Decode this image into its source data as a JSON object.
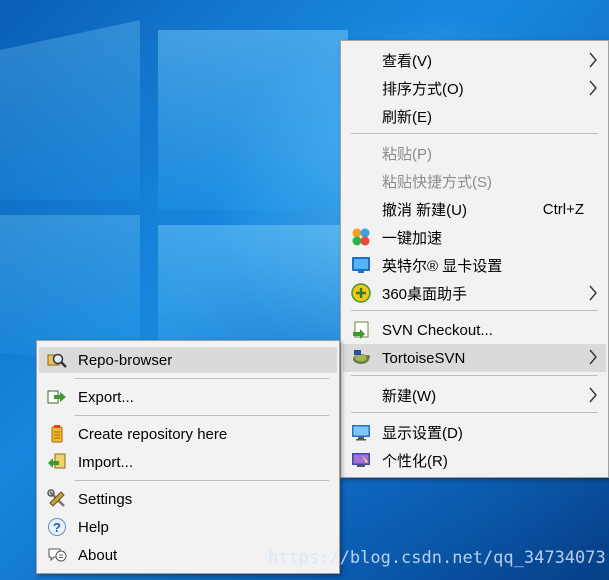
{
  "main_menu": {
    "items": [
      {
        "label": "查看(V)",
        "has_submenu": true
      },
      {
        "label": "排序方式(O)",
        "has_submenu": true
      },
      {
        "label": "刷新(E)"
      },
      {
        "label": "粘贴(P)",
        "disabled": true
      },
      {
        "label": "粘贴快捷方式(S)",
        "disabled": true
      },
      {
        "label": "撤消 新建(U)",
        "shortcut": "Ctrl+Z"
      },
      {
        "label": "一键加速",
        "icon": "speedup-icon"
      },
      {
        "label": "英特尔® 显卡设置",
        "icon": "intel-graphics-icon"
      },
      {
        "label": "360桌面助手",
        "icon": "360-desktop-icon",
        "has_submenu": true
      },
      {
        "label": "SVN Checkout...",
        "icon": "svn-checkout-icon"
      },
      {
        "label": "TortoiseSVN",
        "icon": "tortoisesvn-icon",
        "has_submenu": true,
        "highlighted": true
      },
      {
        "label": "新建(W)",
        "has_submenu": true
      },
      {
        "label": "显示设置(D)",
        "icon": "display-settings-icon"
      },
      {
        "label": "个性化(R)",
        "icon": "personalize-icon"
      }
    ]
  },
  "sub_menu": {
    "items": [
      {
        "label": "Repo-browser",
        "icon": "repo-browser-icon",
        "highlighted": true
      },
      {
        "label": "Export...",
        "icon": "export-icon"
      },
      {
        "label": "Create repository here",
        "icon": "create-repository-icon"
      },
      {
        "label": "Import...",
        "icon": "import-icon"
      },
      {
        "label": "Settings",
        "icon": "settings-icon"
      },
      {
        "label": "Help",
        "icon": "help-icon"
      },
      {
        "label": "About",
        "icon": "about-icon"
      }
    ]
  },
  "watermark": "https://blog.csdn.net/qq_34734073",
  "colors": {
    "menu_bg": "#f2f2f2",
    "highlight": "#dadada",
    "disabled_text": "#8c8c8c"
  }
}
